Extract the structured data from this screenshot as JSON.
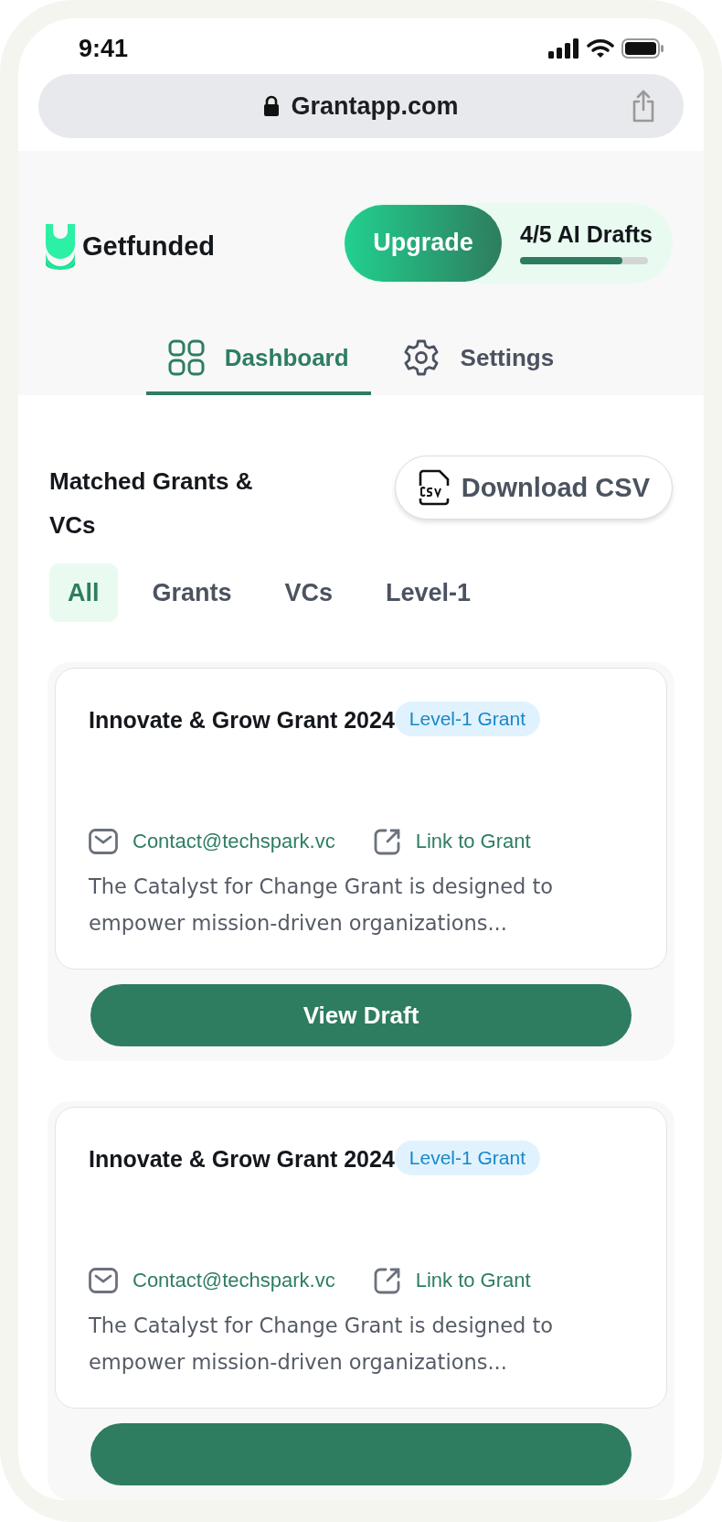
{
  "status_bar": {
    "time": "9:41"
  },
  "browser": {
    "url": "Grantapp.com"
  },
  "header": {
    "logo": "Getfunded",
    "upgrade_button": "Upgrade",
    "drafts": {
      "label": "4/5 AI Drafts",
      "level": 0.8
    }
  },
  "tabs": [
    {
      "label": "Dashboard",
      "selected": true
    },
    {
      "label": "Settings",
      "selected": false
    }
  ],
  "section": {
    "title": "Matched Grants & VCs",
    "download_button": "Download CSV"
  },
  "filters": [
    {
      "label": "All",
      "selected": true
    },
    {
      "label": "Grants",
      "selected": false
    },
    {
      "label": "VCs",
      "selected": false
    },
    {
      "label": "Level-1",
      "selected": false
    }
  ],
  "cards": [
    {
      "title": "Innovate & Grow Grant 2024",
      "badge": "Level-1 Grant",
      "email": "Contact@techspark.vc",
      "link": "Link to Grant",
      "description": "The Catalyst for Change Grant is designed to empower mission-driven organizations...",
      "button": "View Draft"
    },
    {
      "title": "Innovate & Grow Grant 2024",
      "badge": "Level-1 Grant",
      "email": "Contact@techspark.vc",
      "link": "Link to Grant",
      "description": "The Catalyst for Change Grant is designed to empower mission-driven organizations..."
    }
  ]
}
